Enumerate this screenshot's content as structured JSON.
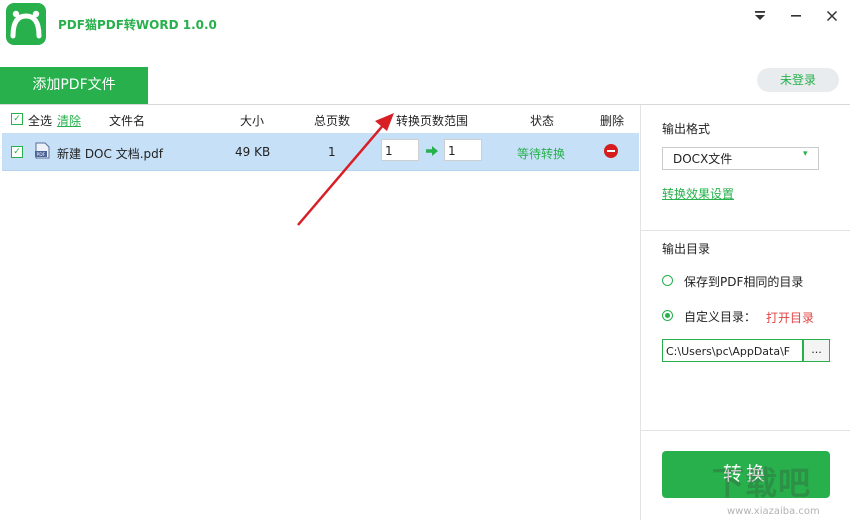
{
  "window": {
    "title": "PDF猫PDF转WORD 1.0.0",
    "minimize_glyph": "–",
    "dropdown_glyph": "▾"
  },
  "tabs": {
    "add_pdf": "添加PDF文件"
  },
  "login": {
    "label": "未登录"
  },
  "list": {
    "headers": {
      "select_all": "全选",
      "clear": "清除",
      "filename": "文件名",
      "size": "大小",
      "total_pages": "总页数",
      "range": "转换页数范围",
      "status": "状态",
      "delete": "删除"
    },
    "rows": [
      {
        "name": "新建 DOC 文档.pdf",
        "size": "49 KB",
        "pages": "1",
        "from": "1",
        "to": "1",
        "status": "等待转换"
      }
    ]
  },
  "panel": {
    "format_label": "输出格式",
    "format_value": "DOCX文件",
    "effect_settings": "转换效果设置",
    "dir_label": "输出目录",
    "option_same": "保存到PDF相同的目录",
    "option_custom": "自定义目录：",
    "open_dir": "打开目录",
    "path": "C:\\Users\\pc\\AppData\\F",
    "browse": "...",
    "convert": "转换"
  },
  "watermark": {
    "text": "下载吧",
    "url": "www.xiazaiba.com"
  },
  "colors": {
    "accent": "#27b04b",
    "row_selected": "#c6e0f8",
    "delete": "#d51d1d",
    "arrow": "#d81f26"
  },
  "icons": [
    "app-logo-icon",
    "minimize-icon",
    "close-icon",
    "pdf-file-icon",
    "delete-icon",
    "dropdown-arrow-icon",
    "arrow-right-icon"
  ]
}
